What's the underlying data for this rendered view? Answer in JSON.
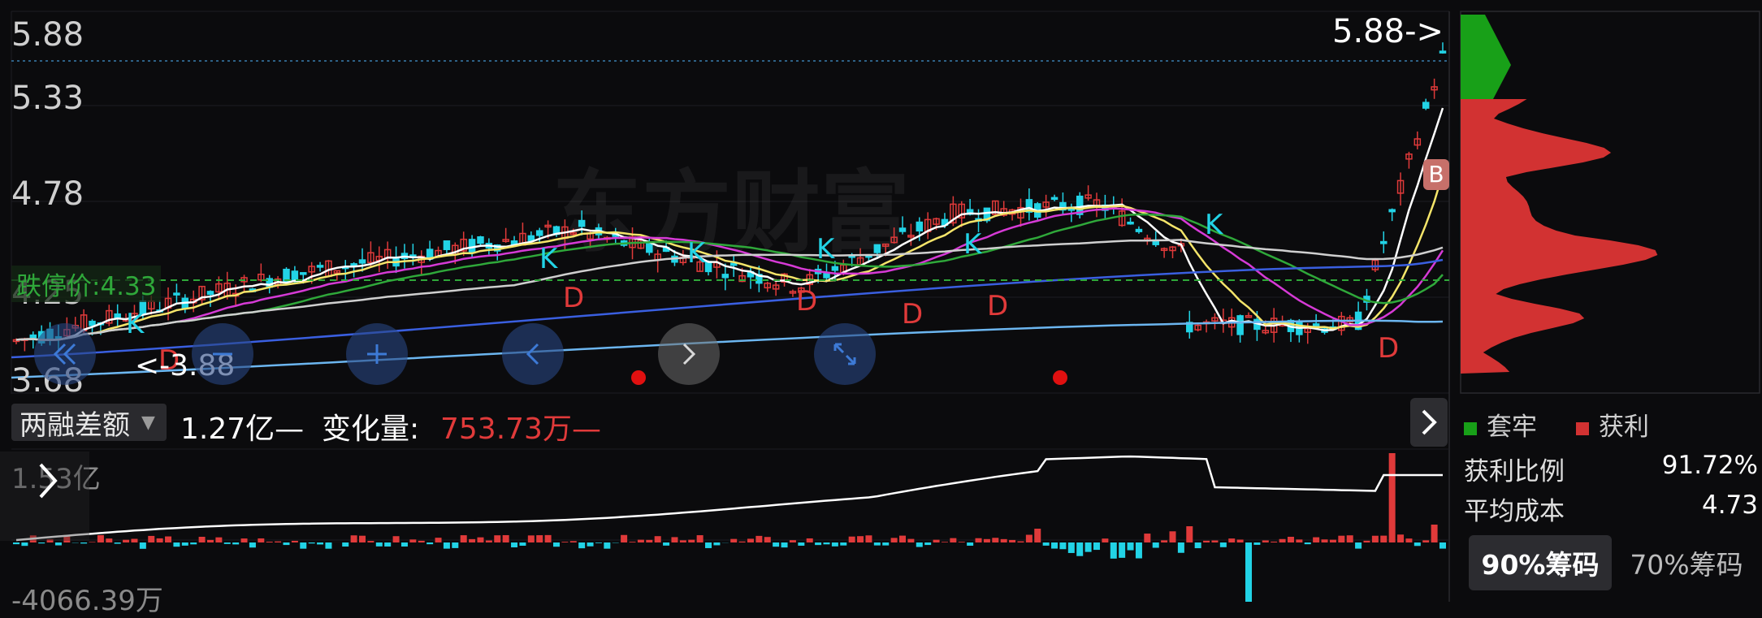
{
  "price_axis": {
    "labels": [
      "5.88",
      "5.33",
      "4.78",
      "4.25",
      "3.68"
    ]
  },
  "watermark": "东方财富",
  "max_marker": "5.88->",
  "min_marker": "<-3.88",
  "limit_down_label": "跌停价:4.33",
  "signals": {
    "k_label": "K",
    "d_label": "D",
    "b_label": "B"
  },
  "indicator": {
    "name": "两融差额",
    "value_text": "1.27亿—",
    "change_label": "变化量:",
    "change_value": "753.73万—",
    "axis_top": "1.53亿",
    "axis_bottom": "-4066.39万"
  },
  "chips": {
    "legend_trapped": "套牢",
    "legend_profit": "获利",
    "profit_ratio_label": "获利比例",
    "profit_ratio_value": "91.72%",
    "avg_cost_label": "平均成本",
    "avg_cost_value": "4.73",
    "tab_90": "90%筹码",
    "tab_70": "70%筹码"
  },
  "colors": {
    "up": "#e03a3a",
    "down": "#22d3e6",
    "ma5": "#ffffff",
    "ma10": "#f5e56a",
    "ma20": "#d63ad6",
    "ma30": "#2fa83a",
    "ma60": "#cfcfcf",
    "ma120": "#3a5fe0",
    "ma250": "#6cb6f0",
    "trapped": "#18a018",
    "profit": "#d23232"
  }
}
